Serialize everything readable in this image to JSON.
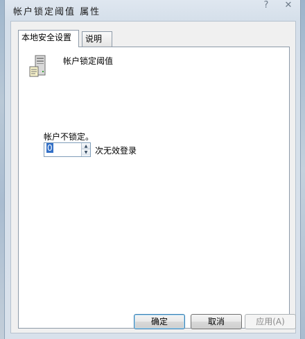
{
  "window": {
    "title": "帐户锁定阈值 属性",
    "help_button": "?",
    "close_button": "✕"
  },
  "tabs": [
    {
      "label": "本地安全设置",
      "active": true
    },
    {
      "label": "说明",
      "active": false
    }
  ],
  "page": {
    "icon": "server-icon",
    "heading": "帐户锁定阈值",
    "field_label": "帐户不锁定。",
    "spin_value": "0",
    "spin_suffix": "次无效登录"
  },
  "buttons": {
    "ok": "确定",
    "cancel": "取消",
    "apply": "应用(A)"
  },
  "colors": {
    "accent": "#3c7fb1",
    "selection": "#3370c7"
  }
}
